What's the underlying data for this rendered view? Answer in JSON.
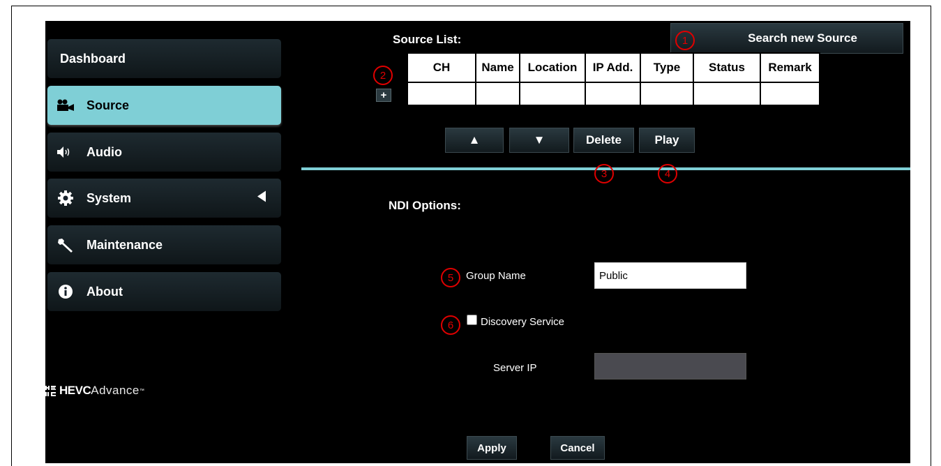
{
  "sidebar": {
    "items": [
      {
        "label": "Dashboard",
        "icon": "none"
      },
      {
        "label": "Source",
        "icon": "video-camera-icon"
      },
      {
        "label": "Audio",
        "icon": "speaker-icon"
      },
      {
        "label": "System",
        "icon": "gear-icon"
      },
      {
        "label": "Maintenance",
        "icon": "wrench-icon"
      },
      {
        "label": "About",
        "icon": "info-icon"
      }
    ],
    "active_index": 1
  },
  "logo": {
    "bold": "HEVC",
    "light": "Advance",
    "tm": "™"
  },
  "source_list": {
    "title": "Source List:",
    "search_button": "Search new Source",
    "add_button": "+",
    "columns": [
      "CH",
      "Name",
      "Location",
      "IP Add.",
      "Type",
      "Status",
      "Remark"
    ],
    "rows": [
      [
        "",
        "",
        "",
        "",
        "",
        "",
        ""
      ]
    ],
    "up_button": "▲",
    "down_button": "▼",
    "delete_button": "Delete",
    "play_button": "Play"
  },
  "ndi": {
    "title": "NDI Options:",
    "group_name_label": "Group Name",
    "group_name_value": "Public",
    "discovery_label": "Discovery Service",
    "discovery_checked": false,
    "server_ip_label": "Server IP",
    "server_ip_value": "",
    "apply_button": "Apply",
    "cancel_button": "Cancel"
  },
  "callouts": [
    "1",
    "2",
    "3",
    "4",
    "5",
    "6"
  ],
  "colors": {
    "accent": "#7fcfd6",
    "callout": "#e00000",
    "background": "#000000"
  }
}
